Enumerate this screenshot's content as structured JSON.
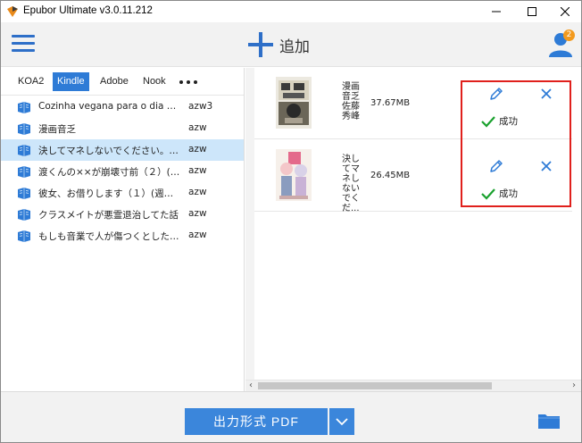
{
  "window": {
    "title": "Epubor Ultimate v3.0.11.212",
    "min_glyph": "—",
    "max_glyph": "☐",
    "close_glyph": "✕"
  },
  "toolbar": {
    "menu_icon": "hamburger-icon",
    "add_label": "追加",
    "user_badge": "2"
  },
  "tabs": [
    {
      "label": "KOA2",
      "active": false
    },
    {
      "label": "Kindle",
      "active": true
    },
    {
      "label": "Adobe",
      "active": false
    },
    {
      "label": "Nook",
      "active": false
    }
  ],
  "books": [
    {
      "title": "Cozinha vegana para o dia a dia",
      "format": "azw3",
      "selected": false
    },
    {
      "title": "漫画音乏",
      "format": "azw",
      "selected": false
    },
    {
      "title": "決してマネしないでください。（…",
      "format": "azw",
      "selected": true
    },
    {
      "title": "渡くんの××が崩壊寸前（２）(ヤ…",
      "format": "azw",
      "selected": false
    },
    {
      "title": "彼女、お借りします（１）(週刊少…",
      "format": "azw",
      "selected": false
    },
    {
      "title": "クラスメイトが悪霊退治してた話",
      "format": "azw",
      "selected": false
    },
    {
      "title": "もしも音業で人が傷つくとしたら…",
      "format": "azw",
      "selected": false
    }
  ],
  "conversions": [
    {
      "num": "1",
      "title": "漫画音乏佐藤秀峰",
      "size": "37.67MB",
      "status": "成功"
    },
    {
      "num": "2",
      "title": "決してマネしないでくだ...",
      "size": "26.45MB",
      "status": "成功"
    }
  ],
  "footer": {
    "output_label": "出力形式 PDF"
  },
  "colors": {
    "accent": "#2e7bd6",
    "success": "#1aa12e",
    "highlight": "#e0201c"
  }
}
